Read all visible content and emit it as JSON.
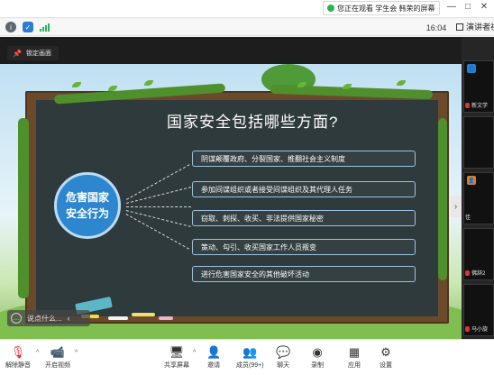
{
  "share_bar": {
    "text": "您正在观看 学生会 韩荣的屏幕"
  },
  "toolbar": {
    "time": "16:04",
    "speaker_view_label": "演讲者视"
  },
  "stage": {
    "lock_label": "锁定画面"
  },
  "slide": {
    "title": "国家安全包括哪些方面?",
    "center": [
      "危害国家",
      "安全行为"
    ],
    "items": [
      "阴谋颠覆政府、分裂国家、推翻社会主义制度",
      "参加间谍组织或者接受间谍组织及其代理人任务",
      "窃取、刺探、收买、非法提供国家秘密",
      "策动、勾引、收买国家工作人员叛变",
      "进行危害国家安全的其他破坏活动"
    ],
    "nav_label": "说点什么..."
  },
  "rail": {
    "tiles": [
      {
        "name": "新文学",
        "avatar": "",
        "avatar_color": ""
      },
      {
        "name": "",
        "avatar": "",
        "avatar_color": ""
      },
      {
        "name": "佳",
        "avatar": "",
        "avatar_color": "#e07b24"
      },
      {
        "name": "佛辞2",
        "avatar": "",
        "avatar_color": ""
      },
      {
        "name": "马小旋",
        "avatar": "",
        "avatar_color": ""
      }
    ]
  },
  "controls": {
    "mute": "解除静音",
    "video": "开启视频",
    "share": "共享屏幕",
    "invite": "邀请",
    "members": "成员(99+)",
    "chat": "聊天",
    "record": "录制",
    "apps": "应用",
    "settings": "设置"
  },
  "colors": {
    "accent": "#2e86cf",
    "board": "#2f3a3c",
    "frame": "#6b4a2c"
  }
}
